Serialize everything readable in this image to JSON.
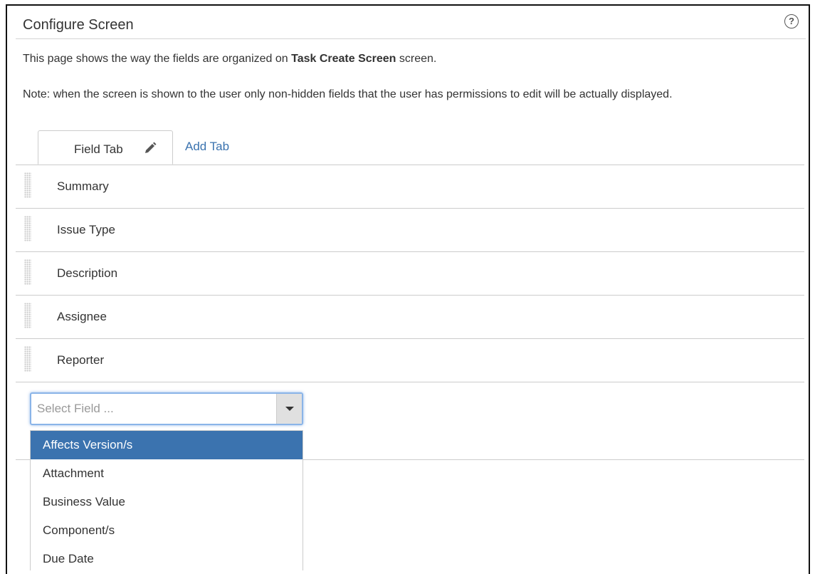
{
  "header": {
    "title": "Configure Screen",
    "help_icon": "question-circle-icon",
    "help_glyph": "?"
  },
  "description": {
    "prefix": "This page shows the way the fields are organized on ",
    "screen_name": "Task Create Screen",
    "suffix": " screen."
  },
  "note": "Note: when the screen is shown to the user only non-hidden fields that the user has permissions to edit will be actually displayed.",
  "tabs": {
    "active_label": "Field Tab",
    "edit_icon": "pencil-icon",
    "add_label": "Add Tab"
  },
  "fields": [
    {
      "label": "Summary"
    },
    {
      "label": "Issue Type"
    },
    {
      "label": "Description"
    },
    {
      "label": "Assignee"
    },
    {
      "label": "Reporter"
    }
  ],
  "select_field": {
    "placeholder": "Select Field ...",
    "value": "",
    "options": [
      {
        "label": "Affects Version/s",
        "highlighted": true
      },
      {
        "label": "Attachment",
        "highlighted": false
      },
      {
        "label": "Business Value",
        "highlighted": false
      },
      {
        "label": "Component/s",
        "highlighted": false
      },
      {
        "label": "Due Date",
        "highlighted": false
      }
    ]
  },
  "colors": {
    "link": "#3b73af",
    "highlight": "#3b73af",
    "border": "#cccccc",
    "text": "#333333"
  }
}
